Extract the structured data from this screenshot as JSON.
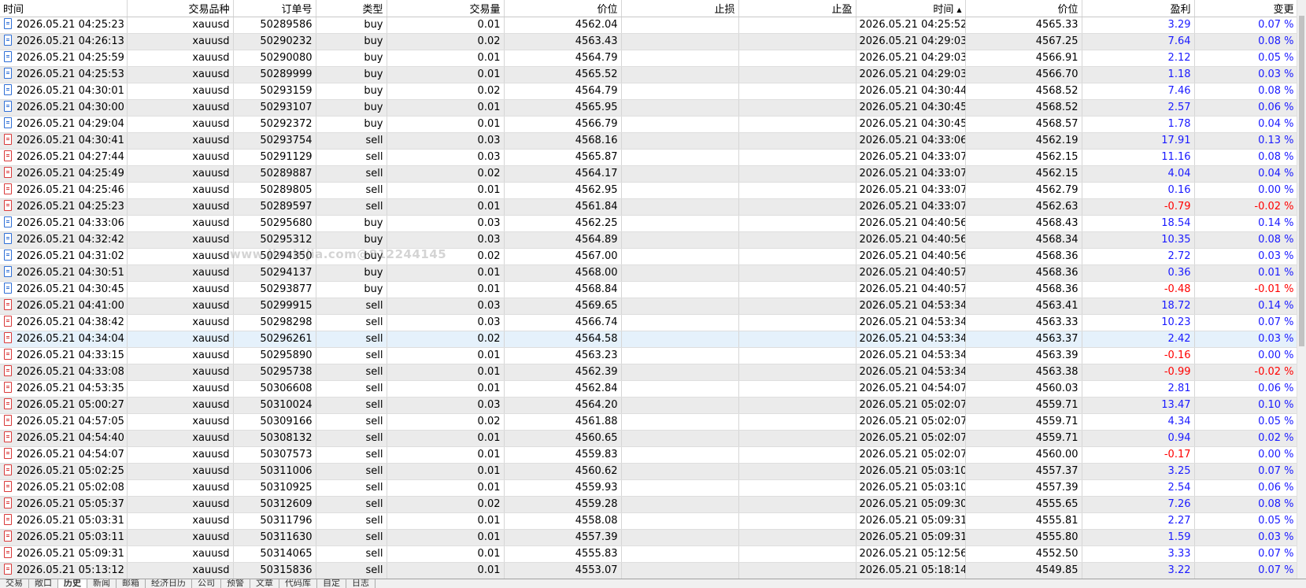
{
  "columns": [
    "时间",
    "交易品种",
    "订单号",
    "类型",
    "交易量",
    "价位",
    "止损",
    "止盈",
    "时间",
    "价位",
    "盈利",
    "变更"
  ],
  "sorted_column": 8,
  "watermark": "www.jinzhijia.com@812244145",
  "tabs": [
    "交易",
    "敞口",
    "历史",
    "新闻",
    "邮箱",
    "经济日历",
    "公司",
    "预警",
    "文章",
    "代码库",
    "自定",
    "日志"
  ],
  "active_tab": 2,
  "selected_row": 19,
  "rows": [
    [
      "2026.05.21 04:25:23",
      "xauusd",
      "50289586",
      "buy",
      "0.01",
      "4562.04",
      "",
      "",
      "2026.05.21 04:25:52",
      "4565.33",
      "3.29",
      "0.07 %"
    ],
    [
      "2026.05.21 04:26:13",
      "xauusd",
      "50290232",
      "buy",
      "0.02",
      "4563.43",
      "",
      "",
      "2026.05.21 04:29:03",
      "4567.25",
      "7.64",
      "0.08 %"
    ],
    [
      "2026.05.21 04:25:59",
      "xauusd",
      "50290080",
      "buy",
      "0.01",
      "4564.79",
      "",
      "",
      "2026.05.21 04:29:03",
      "4566.91",
      "2.12",
      "0.05 %"
    ],
    [
      "2026.05.21 04:25:53",
      "xauusd",
      "50289999",
      "buy",
      "0.01",
      "4565.52",
      "",
      "",
      "2026.05.21 04:29:03",
      "4566.70",
      "1.18",
      "0.03 %"
    ],
    [
      "2026.05.21 04:30:01",
      "xauusd",
      "50293159",
      "buy",
      "0.02",
      "4564.79",
      "",
      "",
      "2026.05.21 04:30:44",
      "4568.52",
      "7.46",
      "0.08 %"
    ],
    [
      "2026.05.21 04:30:00",
      "xauusd",
      "50293107",
      "buy",
      "0.01",
      "4565.95",
      "",
      "",
      "2026.05.21 04:30:45",
      "4568.52",
      "2.57",
      "0.06 %"
    ],
    [
      "2026.05.21 04:29:04",
      "xauusd",
      "50292372",
      "buy",
      "0.01",
      "4566.79",
      "",
      "",
      "2026.05.21 04:30:45",
      "4568.57",
      "1.78",
      "0.04 %"
    ],
    [
      "2026.05.21 04:30:41",
      "xauusd",
      "50293754",
      "sell",
      "0.03",
      "4568.16",
      "",
      "",
      "2026.05.21 04:33:06",
      "4562.19",
      "17.91",
      "0.13 %"
    ],
    [
      "2026.05.21 04:27:44",
      "xauusd",
      "50291129",
      "sell",
      "0.03",
      "4565.87",
      "",
      "",
      "2026.05.21 04:33:07",
      "4562.15",
      "11.16",
      "0.08 %"
    ],
    [
      "2026.05.21 04:25:49",
      "xauusd",
      "50289887",
      "sell",
      "0.02",
      "4564.17",
      "",
      "",
      "2026.05.21 04:33:07",
      "4562.15",
      "4.04",
      "0.04 %"
    ],
    [
      "2026.05.21 04:25:46",
      "xauusd",
      "50289805",
      "sell",
      "0.01",
      "4562.95",
      "",
      "",
      "2026.05.21 04:33:07",
      "4562.79",
      "0.16",
      "0.00 %"
    ],
    [
      "2026.05.21 04:25:23",
      "xauusd",
      "50289597",
      "sell",
      "0.01",
      "4561.84",
      "",
      "",
      "2026.05.21 04:33:07",
      "4562.63",
      "-0.79",
      "-0.02 %"
    ],
    [
      "2026.05.21 04:33:06",
      "xauusd",
      "50295680",
      "buy",
      "0.03",
      "4562.25",
      "",
      "",
      "2026.05.21 04:40:56",
      "4568.43",
      "18.54",
      "0.14 %"
    ],
    [
      "2026.05.21 04:32:42",
      "xauusd",
      "50295312",
      "buy",
      "0.03",
      "4564.89",
      "",
      "",
      "2026.05.21 04:40:56",
      "4568.34",
      "10.35",
      "0.08 %"
    ],
    [
      "2026.05.21 04:31:02",
      "xauusd",
      "50294350",
      "buy",
      "0.02",
      "4567.00",
      "",
      "",
      "2026.05.21 04:40:56",
      "4568.36",
      "2.72",
      "0.03 %"
    ],
    [
      "2026.05.21 04:30:51",
      "xauusd",
      "50294137",
      "buy",
      "0.01",
      "4568.00",
      "",
      "",
      "2026.05.21 04:40:57",
      "4568.36",
      "0.36",
      "0.01 %"
    ],
    [
      "2026.05.21 04:30:45",
      "xauusd",
      "50293877",
      "buy",
      "0.01",
      "4568.84",
      "",
      "",
      "2026.05.21 04:40:57",
      "4568.36",
      "-0.48",
      "-0.01 %"
    ],
    [
      "2026.05.21 04:41:00",
      "xauusd",
      "50299915",
      "sell",
      "0.03",
      "4569.65",
      "",
      "",
      "2026.05.21 04:53:34",
      "4563.41",
      "18.72",
      "0.14 %"
    ],
    [
      "2026.05.21 04:38:42",
      "xauusd",
      "50298298",
      "sell",
      "0.03",
      "4566.74",
      "",
      "",
      "2026.05.21 04:53:34",
      "4563.33",
      "10.23",
      "0.07 %"
    ],
    [
      "2026.05.21 04:34:04",
      "xauusd",
      "50296261",
      "sell",
      "0.02",
      "4564.58",
      "",
      "",
      "2026.05.21 04:53:34",
      "4563.37",
      "2.42",
      "0.03 %"
    ],
    [
      "2026.05.21 04:33:15",
      "xauusd",
      "50295890",
      "sell",
      "0.01",
      "4563.23",
      "",
      "",
      "2026.05.21 04:53:34",
      "4563.39",
      "-0.16",
      "0.00 %"
    ],
    [
      "2026.05.21 04:33:08",
      "xauusd",
      "50295738",
      "sell",
      "0.01",
      "4562.39",
      "",
      "",
      "2026.05.21 04:53:34",
      "4563.38",
      "-0.99",
      "-0.02 %"
    ],
    [
      "2026.05.21 04:53:35",
      "xauusd",
      "50306608",
      "sell",
      "0.01",
      "4562.84",
      "",
      "",
      "2026.05.21 04:54:07",
      "4560.03",
      "2.81",
      "0.06 %"
    ],
    [
      "2026.05.21 05:00:27",
      "xauusd",
      "50310024",
      "sell",
      "0.03",
      "4564.20",
      "",
      "",
      "2026.05.21 05:02:07",
      "4559.71",
      "13.47",
      "0.10 %"
    ],
    [
      "2026.05.21 04:57:05",
      "xauusd",
      "50309166",
      "sell",
      "0.02",
      "4561.88",
      "",
      "",
      "2026.05.21 05:02:07",
      "4559.71",
      "4.34",
      "0.05 %"
    ],
    [
      "2026.05.21 04:54:40",
      "xauusd",
      "50308132",
      "sell",
      "0.01",
      "4560.65",
      "",
      "",
      "2026.05.21 05:02:07",
      "4559.71",
      "0.94",
      "0.02 %"
    ],
    [
      "2026.05.21 04:54:07",
      "xauusd",
      "50307573",
      "sell",
      "0.01",
      "4559.83",
      "",
      "",
      "2026.05.21 05:02:07",
      "4560.00",
      "-0.17",
      "0.00 %"
    ],
    [
      "2026.05.21 05:02:25",
      "xauusd",
      "50311006",
      "sell",
      "0.01",
      "4560.62",
      "",
      "",
      "2026.05.21 05:03:10",
      "4557.37",
      "3.25",
      "0.07 %"
    ],
    [
      "2026.05.21 05:02:08",
      "xauusd",
      "50310925",
      "sell",
      "0.01",
      "4559.93",
      "",
      "",
      "2026.05.21 05:03:10",
      "4557.39",
      "2.54",
      "0.06 %"
    ],
    [
      "2026.05.21 05:05:37",
      "xauusd",
      "50312609",
      "sell",
      "0.02",
      "4559.28",
      "",
      "",
      "2026.05.21 05:09:30",
      "4555.65",
      "7.26",
      "0.08 %"
    ],
    [
      "2026.05.21 05:03:31",
      "xauusd",
      "50311796",
      "sell",
      "0.01",
      "4558.08",
      "",
      "",
      "2026.05.21 05:09:31",
      "4555.81",
      "2.27",
      "0.05 %"
    ],
    [
      "2026.05.21 05:03:11",
      "xauusd",
      "50311630",
      "sell",
      "0.01",
      "4557.39",
      "",
      "",
      "2026.05.21 05:09:31",
      "4555.80",
      "1.59",
      "0.03 %"
    ],
    [
      "2026.05.21 05:09:31",
      "xauusd",
      "50314065",
      "sell",
      "0.01",
      "4555.83",
      "",
      "",
      "2026.05.21 05:12:56",
      "4552.50",
      "3.33",
      "0.07 %"
    ],
    [
      "2026.05.21 05:13:12",
      "xauusd",
      "50315836",
      "sell",
      "0.01",
      "4553.07",
      "",
      "",
      "2026.05.21 05:18:14",
      "4549.85",
      "3.22",
      "0.07 %"
    ]
  ]
}
